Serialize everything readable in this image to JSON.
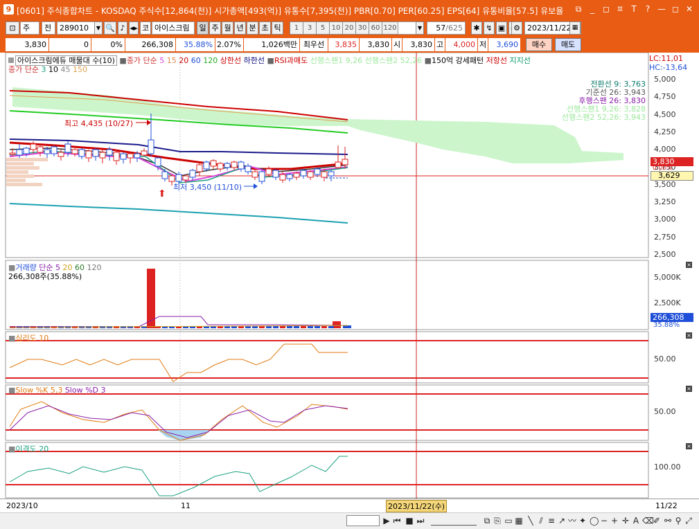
{
  "window": {
    "app_number": "9",
    "title": "[0601] 주식종합차트 - KOSDAQ 주식수[12,864(천)] 시가총액[493(억)] 유통수[7,395(천)] PBR[0.70] PER[60.25] EPS[64] 유통비율[57.5] 유보율",
    "buttons": [
      "⧉",
      "—",
      "◻",
      "ㅍ",
      "T",
      "?",
      "—",
      "◻",
      "✕"
    ]
  },
  "toolbar": {
    "period_type": "주",
    "view_mode": "전",
    "stock_code": "289010",
    "market_flag": "코",
    "stock_name": "아이스크림",
    "periods": [
      "일",
      "주",
      "월",
      "년",
      "분",
      "초",
      "틱"
    ],
    "active_period": "일",
    "intervals": [
      "1",
      "3",
      "5",
      "10",
      "20",
      "30",
      "60",
      "120"
    ],
    "count": "57",
    "count_total": "/625",
    "date": "2023/11/22"
  },
  "quote": {
    "price": "3,830",
    "change": "0",
    "change_pct": "0%",
    "volume": "266,308",
    "vol_ratio": "35.88%",
    "turnover_pct": "2.07%",
    "amount": "1,026백만",
    "best_label": "최우선",
    "best_ask": "3,835",
    "best_bid": "3,830",
    "open_label": "시",
    "open": "3,830",
    "high_label": "고",
    "high": "4,000",
    "low_label": "저",
    "low": "3,690",
    "buy_label": "매수",
    "sell_label": "매도"
  },
  "price_pane": {
    "legend_name": "아이스크림에듀 매물대 수(10)",
    "legend_close": "종가 단순",
    "ma_periods_a": [
      "5",
      "15",
      "20",
      "60",
      "120"
    ],
    "upper_line": "상한선",
    "lower_line": "하한선",
    "rsi": "RSI과매도",
    "span1_legend": "선행스팬1 9,26",
    "span2_legend": "선행스팬2 52,26",
    "pattern": "150억 강세패턴",
    "resist": "저항선",
    "support": "지지선",
    "legend_close2": "종가 단순",
    "ma_periods_b": [
      "3",
      "10",
      "45",
      "150"
    ],
    "lc": "LC:11,01",
    "hc": "HC:-13,64",
    "ichimoku": [
      {
        "label": "전환선 9: 3,763",
        "color": "#0a7a6a"
      },
      {
        "label": "기준선 26: 3,943",
        "color": "#555555"
      },
      {
        "label": "후행스팬 26: 3,830",
        "color": "#8a1ea8"
      },
      {
        "label": "선행스팬1 9,26: 3,828",
        "color": "#9be89b"
      },
      {
        "label": "선행스팬2 52,26: 3,943",
        "color": "#9be89b"
      }
    ],
    "high_annotation": "최고 4,435 (10/27)",
    "low_annotation": "최저 3,450 (11/10)",
    "yaxis": [
      "5,000",
      "4,750",
      "4,500",
      "4,250",
      "4,000",
      "3,750",
      "3,500",
      "3,250",
      "3,000",
      "2,750",
      "2,500"
    ],
    "current_price_tag": "3,830",
    "zero_pct_tag": "0.00%",
    "reference_tag": "3,629"
  },
  "volume_pane": {
    "label": "거래량",
    "ma_label": "단순",
    "ma_periods": [
      "5",
      "20",
      "60",
      "120"
    ],
    "info": "266,308주(35.88%)",
    "yaxis": [
      "5,000K",
      "2,500K"
    ],
    "current_tag": "266,308",
    "current_pct": "35.88%"
  },
  "psy_pane": {
    "label": "심리도 10",
    "yaxis": [
      "50.00"
    ]
  },
  "slow_pane": {
    "label_k": "Slow %K 5,3",
    "label_d": "Slow %D 3",
    "yaxis": [
      "50.00"
    ]
  },
  "disparity_pane": {
    "label": "이격도 20",
    "yaxis": [
      "100.00"
    ]
  },
  "xaxis": {
    "left": "2023/10",
    "mid": "11",
    "cursor": "2023/11/22(수)",
    "right": "11/22"
  },
  "colors": {
    "title_bg": "#e85c14",
    "up": "#dd2222",
    "down": "#1f4fd8",
    "cloud": "#ccf5cc",
    "price_tag": "#dd2222",
    "volume_tag": "#1f4fd8"
  }
}
